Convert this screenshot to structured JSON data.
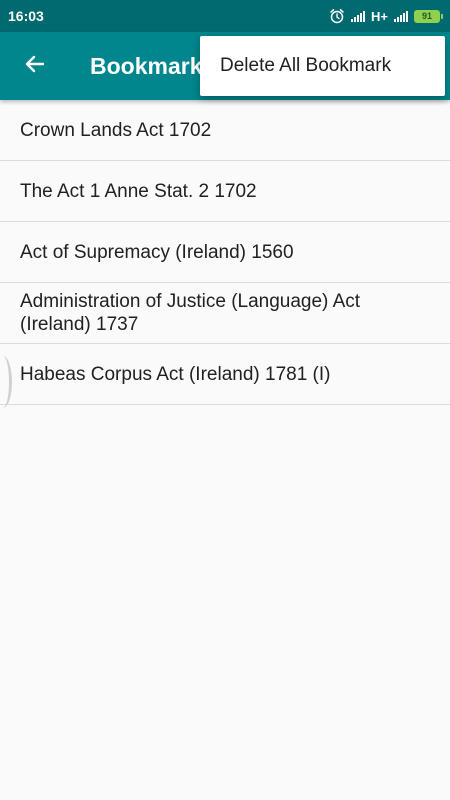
{
  "status_bar": {
    "time": "16:03",
    "network_type": "H+",
    "battery_level": "91",
    "icons": [
      "alarm-icon",
      "signal-icon",
      "signal-icon",
      "battery-icon"
    ]
  },
  "app_bar": {
    "back_icon": "arrow-left-icon",
    "title": "Bookmark"
  },
  "bookmarks": [
    "Crown Lands Act 1702",
    "The Act 1 Anne Stat. 2 1702",
    "Act of Supremacy (Ireland) 1560",
    "Administration of Justice (Language) Act (Ireland) 1737",
    "Habeas Corpus Act (Ireland) 1781 (I)"
  ],
  "overflow_menu": {
    "items": [
      "Delete All Bookmark"
    ]
  },
  "colors": {
    "status_bar": "#006a70",
    "app_bar": "#00868c",
    "background": "#fafafa",
    "battery": "#8fd14f"
  }
}
